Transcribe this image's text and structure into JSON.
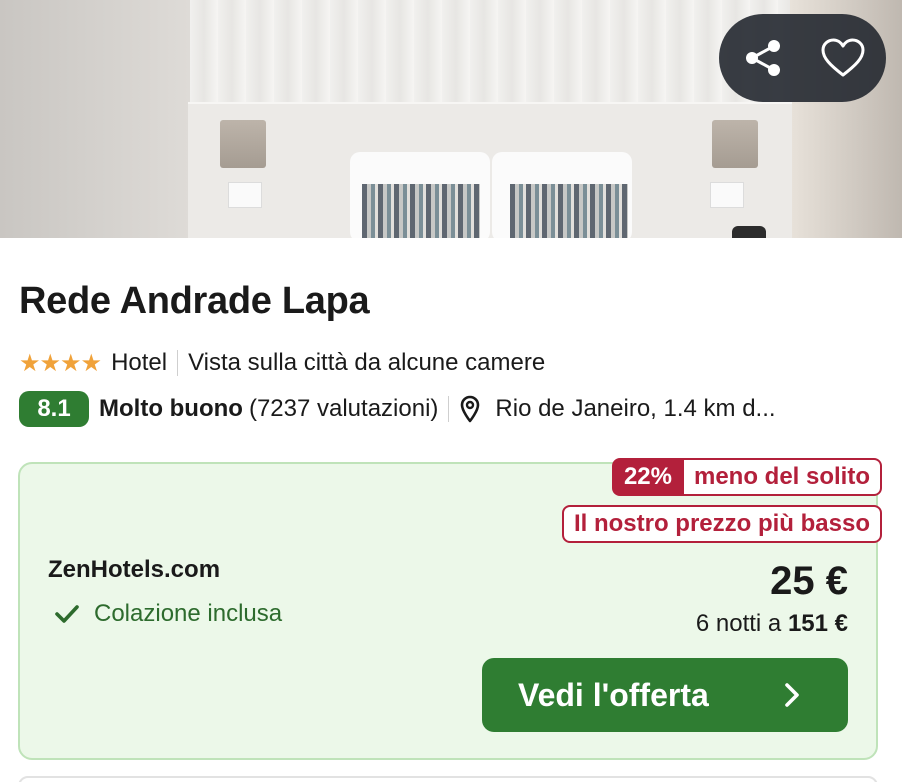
{
  "photo": {
    "alt_subject": "hotel-room-photo"
  },
  "actions": {
    "share_icon": "share-icon",
    "favorite_icon": "heart-icon"
  },
  "hotel": {
    "name": "Rede Andrade Lapa",
    "stars": 4,
    "stars_text": "★★★★",
    "type": "Hotel",
    "feature": "Vista sulla città da alcune camere",
    "score": "8.1",
    "rating_word": "Molto buono",
    "reviews": "(7237 valutazioni)",
    "location": "Rio de Janeiro, 1.4 km d..."
  },
  "offer": {
    "discount_pct": "22%",
    "discount_text": "meno del solito",
    "lowest_label": "Il nostro prezzo più basso",
    "provider": "ZenHotels.com",
    "perk": "Colazione inclusa",
    "price": "25 €",
    "nights_prefix": "6 notti a",
    "nights_total": "151 €",
    "cta_label": "Vedi l'offerta"
  },
  "colors": {
    "accent_green": "#2f7d32",
    "deal_red": "#b3203b",
    "offer_bg": "#ecf8e9",
    "star": "#f0a23a"
  }
}
